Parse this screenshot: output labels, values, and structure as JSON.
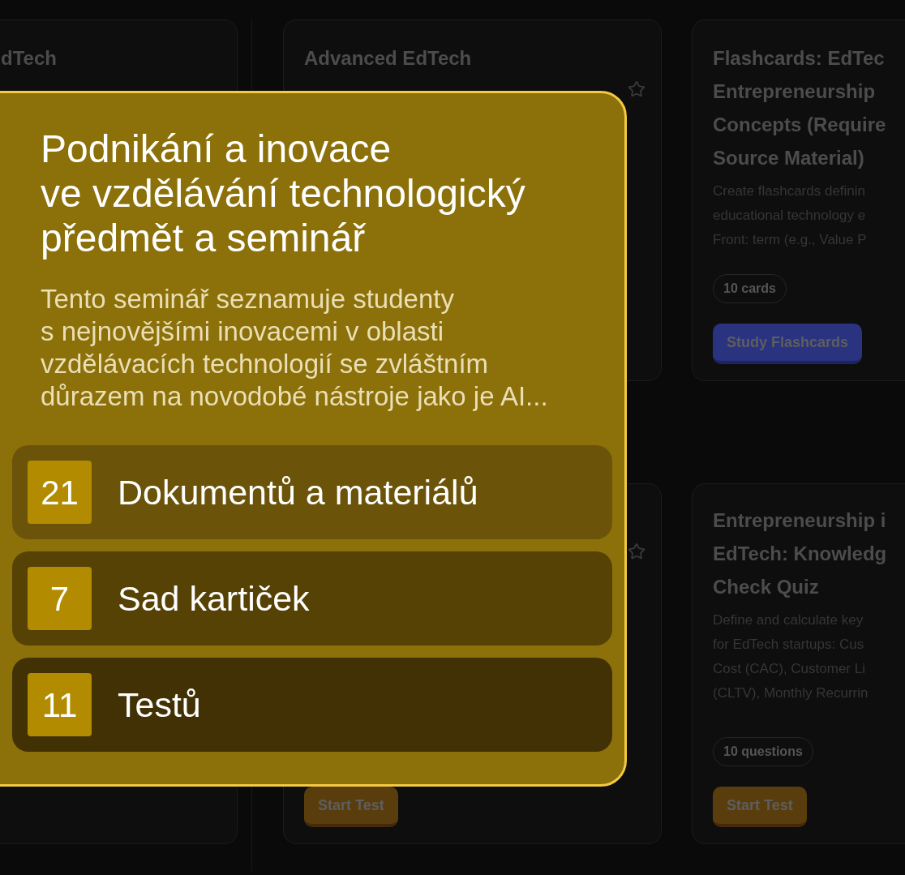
{
  "card_columns": [
    {
      "cards": [
        {
          "title_lines": [
            "dTech"
          ]
        }
      ]
    },
    {
      "cards": [
        {
          "title_lines": [
            "Advanced EdTech"
          ],
          "starred": false
        },
        {
          "starred": false,
          "button": {
            "label": "Start Test",
            "kind": "test"
          }
        }
      ]
    },
    {
      "cards": [
        {
          "title_lines": [
            "Flashcards: EdTec",
            "Entrepreneurship",
            "Concepts (Require",
            "Source Material)"
          ],
          "description_lines": [
            "Create flashcards definin",
            "educational technology e",
            "Front: term (e.g., Value P"
          ],
          "badge": "10 cards",
          "button": {
            "label": "Study Flashcards",
            "kind": "flashcards"
          }
        },
        {
          "title_lines": [
            "Entrepreneurship i",
            "EdTech: Knowledg",
            "Check Quiz"
          ],
          "description_lines": [
            "Define and calculate key",
            "for EdTech startups: Cus",
            "Cost (CAC), Customer Li",
            "(CLTV), Monthly Recurrin"
          ],
          "badge": "10 questions",
          "button": {
            "label": "Start Test",
            "kind": "test"
          }
        }
      ]
    }
  ],
  "course_panel": {
    "title": "Podnikání a inovace\nve vzdělávání technologický\npředmět a seminář",
    "description": "Tento seminář seznamuje studenty\ns nejnovějšími inovacemi v oblasti\nvzdělávacích technologií se zvláštním\ndůrazem na novodobé nástroje jako je AI...",
    "stats": [
      {
        "count": "21",
        "label": "Dokumentů a materiálů"
      },
      {
        "count": "7",
        "label": "Sad kartiček"
      },
      {
        "count": "11",
        "label": "Testů"
      }
    ]
  }
}
